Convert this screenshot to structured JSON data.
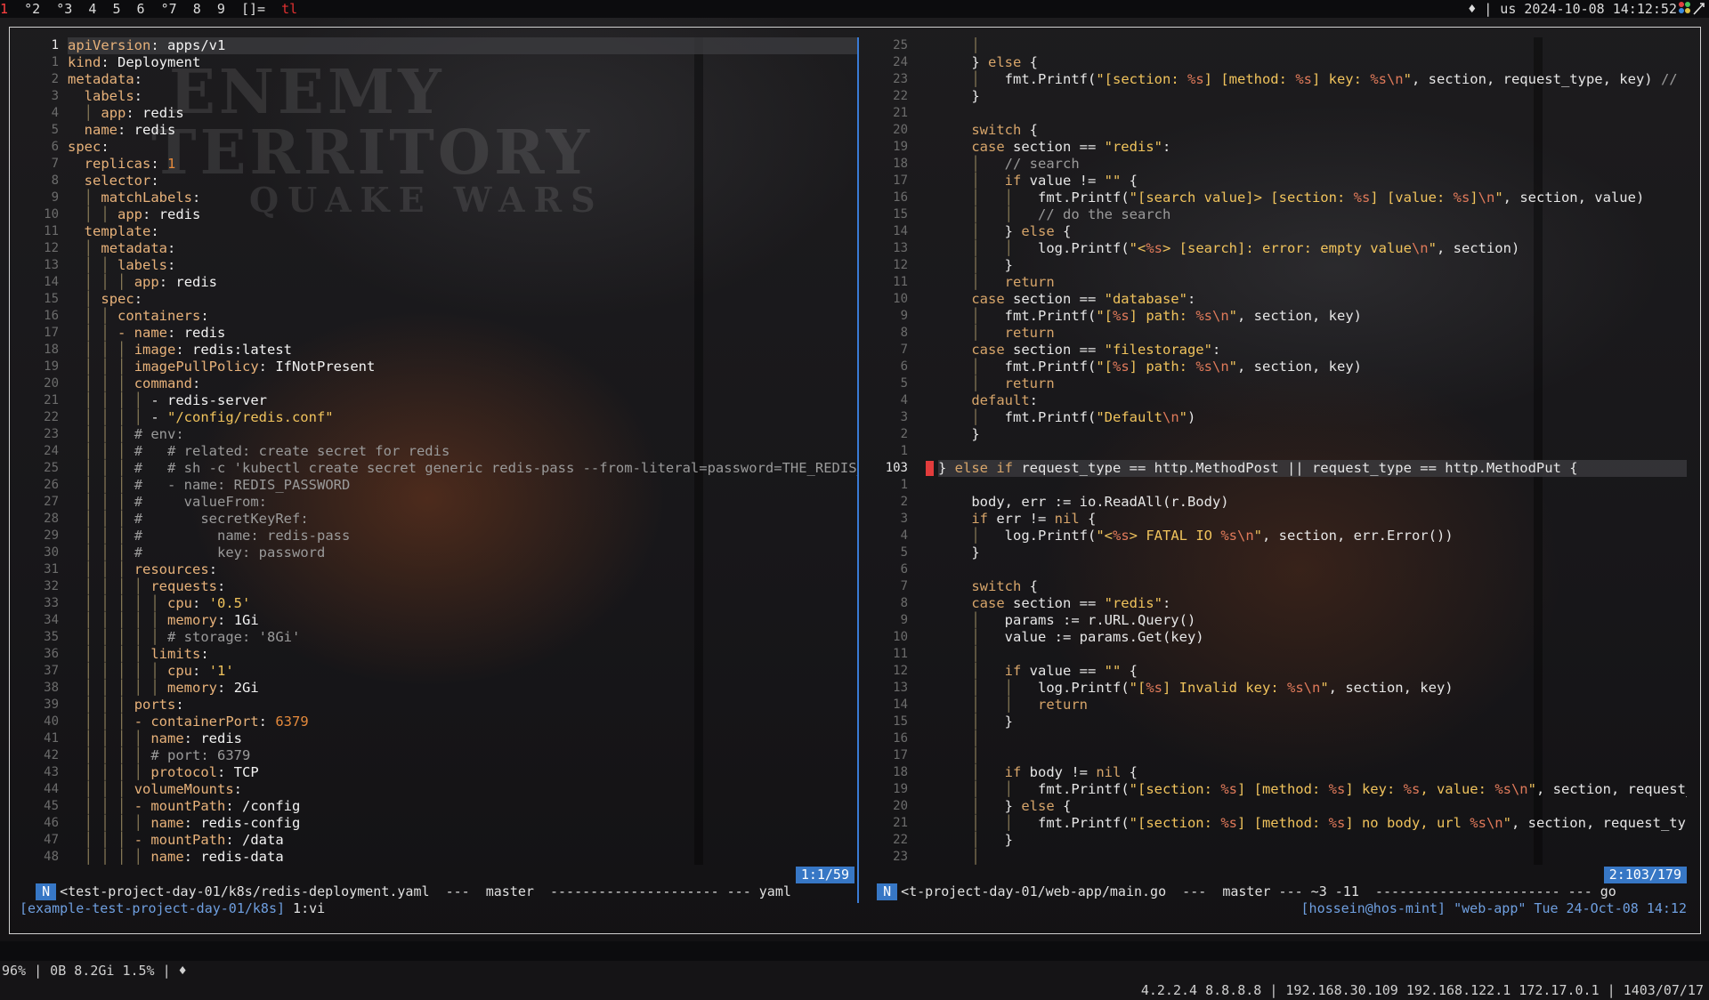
{
  "topbar": {
    "workspaces": [
      {
        "label": "1",
        "current": true
      },
      {
        "label": "°2",
        "current": false
      },
      {
        "label": "°3",
        "current": false
      },
      {
        "label": "4",
        "current": false
      },
      {
        "label": "5",
        "current": false
      },
      {
        "label": "6",
        "current": false
      },
      {
        "label": "°7",
        "current": false
      },
      {
        "label": "8",
        "current": false
      },
      {
        "label": "9",
        "current": false
      }
    ],
    "layout": "[]=",
    "tag": "tl",
    "status_right": "♦ | us 2024-10-08 14:12:52",
    "colors": {
      "active": "#ff4040",
      "accent": "#3777c5"
    }
  },
  "left_pane": {
    "lines": [
      {
        "n": "1",
        "html": "<span class='k'>apiVersion</span>: <span class='v'>apps/v1</span>",
        "current": true
      },
      {
        "n": "1",
        "html": "<span class='k'>kind</span>: <span class='v'>Deployment</span>"
      },
      {
        "n": "2",
        "html": "<span class='k'>metadata</span>:"
      },
      {
        "n": "3",
        "html": "  <span class='k'>labels</span>:"
      },
      {
        "n": "4",
        "html": "  <span class='guide'>│</span> <span class='k'>app</span>: <span class='v'>redis</span>"
      },
      {
        "n": "5",
        "html": "  <span class='k'>name</span>: <span class='v'>redis</span>"
      },
      {
        "n": "6",
        "html": "<span class='k'>spec</span>:"
      },
      {
        "n": "7",
        "html": "  <span class='k'>replicas</span>: <span class='n'>1</span>"
      },
      {
        "n": "8",
        "html": "  <span class='k'>selector</span>:"
      },
      {
        "n": "9",
        "html": "  <span class='guide'>│</span> <span class='k'>matchLabels</span>:"
      },
      {
        "n": "10",
        "html": "  <span class='guide'>│ │</span> <span class='k'>app</span>: <span class='v'>redis</span>"
      },
      {
        "n": "11",
        "html": "  <span class='k'>template</span>:"
      },
      {
        "n": "12",
        "html": "  <span class='guide'>│</span> <span class='k'>metadata</span>:"
      },
      {
        "n": "13",
        "html": "  <span class='guide'>│ │</span> <span class='k'>labels</span>:"
      },
      {
        "n": "14",
        "html": "  <span class='guide'>│ │ │</span> <span class='k'>app</span>: <span class='v'>redis</span>"
      },
      {
        "n": "15",
        "html": "  <span class='guide'>│</span> <span class='k'>spec</span>:"
      },
      {
        "n": "16",
        "html": "  <span class='guide'>│ │</span> <span class='k'>containers</span>:"
      },
      {
        "n": "17",
        "html": "  <span class='guide'>│ │</span> <span class='k'>- name</span>: <span class='v'>redis</span>"
      },
      {
        "n": "18",
        "html": "  <span class='guide'>│ │ │</span> <span class='k'>image</span>: <span class='v'>redis:latest</span>"
      },
      {
        "n": "19",
        "html": "  <span class='guide'>│ │ │</span> <span class='k'>imagePullPolicy</span>: <span class='v'>IfNotPresent</span>"
      },
      {
        "n": "20",
        "html": "  <span class='guide'>│ │ │</span> <span class='k'>command</span>:"
      },
      {
        "n": "21",
        "html": "  <span class='guide'>│ │ │ │</span> - <span class='v'>redis-server</span>"
      },
      {
        "n": "22",
        "html": "  <span class='guide'>│ │ │ │</span> - <span class='s'>\"/config/redis.conf\"</span>"
      },
      {
        "n": "23",
        "html": "  <span class='guide'>│ │ │</span> <span class='c'># env:</span>"
      },
      {
        "n": "24",
        "html": "  <span class='guide'>│ │ │</span> <span class='c'>#   # related: create secret for redis</span>"
      },
      {
        "n": "25",
        "html": "  <span class='guide'>│ │ │</span> <span class='c'>#   # sh -c 'kubectl create secret generic redis-pass --from-literal=password=THE_REDIS_PA</span>"
      },
      {
        "n": "26",
        "html": "  <span class='guide'>│ │ │</span> <span class='c'>#   - name: REDIS_PASSWORD</span>"
      },
      {
        "n": "27",
        "html": "  <span class='guide'>│ │ │</span> <span class='c'>#     valueFrom:</span>"
      },
      {
        "n": "28",
        "html": "  <span class='guide'>│ │ │</span> <span class='c'>#       secretKeyRef:</span>"
      },
      {
        "n": "29",
        "html": "  <span class='guide'>│ │ │</span> <span class='c'>#         name: redis-pass</span>"
      },
      {
        "n": "30",
        "html": "  <span class='guide'>│ │ │</span> <span class='c'>#         key: password</span>"
      },
      {
        "n": "31",
        "html": "  <span class='guide'>│ │ │</span> <span class='k'>resources</span>:"
      },
      {
        "n": "32",
        "html": "  <span class='guide'>│ │ │ │</span> <span class='k'>requests</span>:"
      },
      {
        "n": "33",
        "html": "  <span class='guide'>│ │ │ │ │</span> <span class='k'>cpu</span>: <span class='s'>'0.5'</span>"
      },
      {
        "n": "34",
        "html": "  <span class='guide'>│ │ │ │ │</span> <span class='k'>memory</span>: <span class='v'>1Gi</span>"
      },
      {
        "n": "35",
        "html": "  <span class='guide'>│ │ │ │ │</span> <span class='c'># storage: '8Gi'</span>"
      },
      {
        "n": "36",
        "html": "  <span class='guide'>│ │ │ │</span> <span class='k'>limits</span>:"
      },
      {
        "n": "37",
        "html": "  <span class='guide'>│ │ │ │ │</span> <span class='k'>cpu</span>: <span class='s'>'1'</span>"
      },
      {
        "n": "38",
        "html": "  <span class='guide'>│ │ │ │ │</span> <span class='k'>memory</span>: <span class='v'>2Gi</span>"
      },
      {
        "n": "39",
        "html": "  <span class='guide'>│ │ │</span> <span class='k'>ports</span>:"
      },
      {
        "n": "40",
        "html": "  <span class='guide'>│ │ │</span> <span class='k'>- containerPort</span>: <span class='n'>6379</span>"
      },
      {
        "n": "41",
        "html": "  <span class='guide'>│ │ │ │</span> <span class='k'>name</span>: <span class='v'>redis</span>"
      },
      {
        "n": "42",
        "html": "  <span class='guide'>│ │ │ │</span> <span class='c'># port: 6379</span>"
      },
      {
        "n": "43",
        "html": "  <span class='guide'>│ │ │ │</span> <span class='k'>protocol</span>: <span class='v'>TCP</span>"
      },
      {
        "n": "44",
        "html": "  <span class='guide'>│ │ │</span> <span class='k'>volumeMounts</span>:"
      },
      {
        "n": "45",
        "html": "  <span class='guide'>│ │ │</span> <span class='k'>- mountPath</span>: <span class='v'>/config</span>"
      },
      {
        "n": "46",
        "html": "  <span class='guide'>│ │ │ │</span> <span class='k'>name</span>: <span class='v'>redis-config</span>"
      },
      {
        "n": "47",
        "html": "  <span class='guide'>│ │ │</span> <span class='k'>- mountPath</span>: <span class='v'>/data</span>"
      },
      {
        "n": "48",
        "html": "  <span class='guide'>│ │ │ │</span> <span class='k'>name</span>: <span class='v'>redis-data</span>"
      }
    ],
    "status": {
      "mode": "N",
      "text": "<test-project-day-01/k8s/redis-deployment.yaml  ---  master  --------------------- --- yaml",
      "position": "1:1/59"
    }
  },
  "right_pane": {
    "lines": [
      {
        "n": "25",
        "html": "    <span class='guide'>│</span>"
      },
      {
        "n": "24",
        "html": "    } <span class='kw'>else</span> {"
      },
      {
        "n": "23",
        "html": "    <span class='guide'>│</span>   fmt.Printf(<span class='s'>\"[section: </span><span class='fmt'>%s</span><span class='s'>] [method: </span><span class='fmt'>%s</span><span class='s'>] key: </span><span class='fmt'>%s\\n</span><span class='s'>\"</span>, section, request_type, key) <span class='c'>// typ</span>"
      },
      {
        "n": "22",
        "html": "    }"
      },
      {
        "n": "21",
        "html": ""
      },
      {
        "n": "20",
        "html": "    <span class='kw'>switch</span> {"
      },
      {
        "n": "19",
        "html": "    <span class='kw'>case</span> section == <span class='s'>\"redis\"</span>:"
      },
      {
        "n": "18",
        "html": "    <span class='guide'>│</span>   <span class='c'>// search</span>"
      },
      {
        "n": "17",
        "html": "    <span class='guide'>│</span>   <span class='kw'>if</span> value != <span class='s'>\"\"</span> {"
      },
      {
        "n": "16",
        "html": "    <span class='guide'>│   │</span>   fmt.Printf(<span class='s'>\"[search value]&gt; [section: </span><span class='fmt'>%s</span><span class='s'>] [value: </span><span class='fmt'>%s</span><span class='s'>]</span><span class='fmt'>\\n</span><span class='s'>\"</span>, section, value)"
      },
      {
        "n": "15",
        "html": "    <span class='guide'>│   │</span>   <span class='c'>// do the search</span>"
      },
      {
        "n": "14",
        "html": "    <span class='guide'>│</span>   } <span class='kw'>else</span> {"
      },
      {
        "n": "13",
        "html": "    <span class='guide'>│   │</span>   log.Printf(<span class='s'>\"&lt;</span><span class='fmt'>%s</span><span class='s'>&gt; [search]: error: empty value</span><span class='fmt'>\\n</span><span class='s'>\"</span>, section)"
      },
      {
        "n": "12",
        "html": "    <span class='guide'>│</span>   }"
      },
      {
        "n": "11",
        "html": "    <span class='guide'>│</span>   <span class='kw'>return</span>"
      },
      {
        "n": "10",
        "html": "    <span class='kw'>case</span> section == <span class='s'>\"database\"</span>:"
      },
      {
        "n": "9",
        "html": "    <span class='guide'>│</span>   fmt.Printf(<span class='s'>\"[</span><span class='fmt'>%s</span><span class='s'>] path: </span><span class='fmt'>%s\\n</span><span class='s'>\"</span>, section, key)"
      },
      {
        "n": "8",
        "html": "    <span class='guide'>│</span>   <span class='kw'>return</span>"
      },
      {
        "n": "7",
        "html": "    <span class='kw'>case</span> section == <span class='s'>\"filestorage\"</span>:"
      },
      {
        "n": "6",
        "html": "    <span class='guide'>│</span>   fmt.Printf(<span class='s'>\"[</span><span class='fmt'>%s</span><span class='s'>] path: </span><span class='fmt'>%s\\n</span><span class='s'>\"</span>, section, key)"
      },
      {
        "n": "5",
        "html": "    <span class='guide'>│</span>   <span class='kw'>return</span>"
      },
      {
        "n": "4",
        "html": "    <span class='kw'>default</span>:"
      },
      {
        "n": "3",
        "html": "    <span class='guide'>│</span>   fmt.Printf(<span class='s'>\"Default</span><span class='fmt'>\\n</span><span class='s'>\"</span>)"
      },
      {
        "n": "2",
        "html": "    }"
      },
      {
        "n": "1",
        "html": ""
      },
      {
        "n": "103",
        "html": "} <span class='kw'>else if</span> request_type == http.MethodPost || request_type == http.MethodPut {",
        "current": true
      },
      {
        "n": "1",
        "html": ""
      },
      {
        "n": "2",
        "html": "    body, err := io.ReadAll(r.Body)"
      },
      {
        "n": "3",
        "html": "    <span class='kw'>if</span> err != <span class='kw'>nil</span> {"
      },
      {
        "n": "4",
        "html": "    <span class='guide'>│</span>   log.Printf(<span class='s'>\"&lt;</span><span class='fmt'>%s</span><span class='s'>&gt; FATAL IO </span><span class='fmt'>%s\\n</span><span class='s'>\"</span>, section, err.Error())"
      },
      {
        "n": "5",
        "html": "    }"
      },
      {
        "n": "6",
        "html": ""
      },
      {
        "n": "7",
        "html": "    <span class='kw'>switch</span> {"
      },
      {
        "n": "8",
        "html": "    <span class='kw'>case</span> section == <span class='s'>\"redis\"</span>:"
      },
      {
        "n": "9",
        "html": "    <span class='guide'>│</span>   params := r.URL.Query()"
      },
      {
        "n": "10",
        "html": "    <span class='guide'>│</span>   value := params.Get(key)"
      },
      {
        "n": "11",
        "html": "    <span class='guide'>│</span>"
      },
      {
        "n": "12",
        "html": "    <span class='guide'>│</span>   <span class='kw'>if</span> value == <span class='s'>\"\"</span> {"
      },
      {
        "n": "13",
        "html": "    <span class='guide'>│   │</span>   log.Printf(<span class='s'>\"[</span><span class='fmt'>%s</span><span class='s'>] Invalid key: </span><span class='fmt'>%s\\n</span><span class='s'>\"</span>, section, key)"
      },
      {
        "n": "14",
        "html": "    <span class='guide'>│   │</span>   <span class='kw'>return</span>"
      },
      {
        "n": "15",
        "html": "    <span class='guide'>│</span>   }"
      },
      {
        "n": "16",
        "html": "    <span class='guide'>│</span>"
      },
      {
        "n": "17",
        "html": "    <span class='guide'>│</span>"
      },
      {
        "n": "18",
        "html": "    <span class='guide'>│</span>   <span class='kw'>if</span> body != <span class='kw'>nil</span> {"
      },
      {
        "n": "19",
        "html": "    <span class='guide'>│   │</span>   fmt.Printf(<span class='s'>\"[section: </span><span class='fmt'>%s</span><span class='s'>] [method: </span><span class='fmt'>%s</span><span class='s'>] key: </span><span class='fmt'>%s</span><span class='s'>, value: </span><span class='fmt'>%s\\n</span><span class='s'>\"</span>, section, request_ty"
      },
      {
        "n": "20",
        "html": "    <span class='guide'>│</span>   } <span class='kw'>else</span> {"
      },
      {
        "n": "21",
        "html": "    <span class='guide'>│   │</span>   fmt.Printf(<span class='s'>\"[section: </span><span class='fmt'>%s</span><span class='s'>] [method: </span><span class='fmt'>%s</span><span class='s'>] no body, url </span><span class='fmt'>%s\\n</span><span class='s'>\"</span>, section, request_type,"
      },
      {
        "n": "22",
        "html": "    <span class='guide'>│</span>   }"
      },
      {
        "n": "23",
        "html": "    <span class='guide'>│</span>"
      }
    ],
    "status": {
      "mode": "N",
      "text": "<t-project-day-01/web-app/main.go  ---  master --- ~3 -11  ----------------------- --- go",
      "position": "2:103/179"
    }
  },
  "tmux": {
    "session": "[example-test-project-day-01/k8s]",
    "window": "1:vi",
    "right": "[hossein@hos-mint] \"web-app\" Tue 24-Oct-08 14:12"
  },
  "bottombar": {
    "left": "96% | 0B 8.2Gi 1.5% | ♦",
    "right": "4.2.2.4 8.8.8.8 | 192.168.30.109 192.168.122.1 172.17.0.1 | 1403/07/17"
  },
  "wallpaper": {
    "lines": [
      "ENEMY",
      "TERRITORY",
      "QUAKE WARS"
    ]
  }
}
